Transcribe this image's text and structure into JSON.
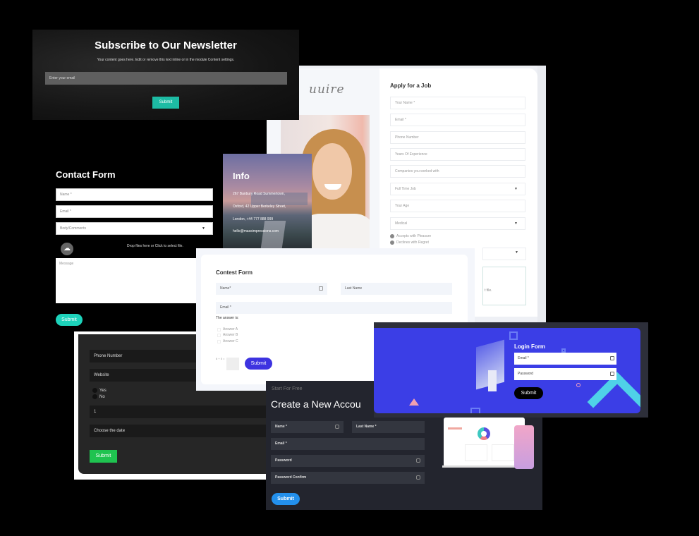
{
  "newsletter": {
    "title": "Subscribe to Our Newsletter",
    "description": "Your content goes here. Edit or remove this text inline or in the module Content settings.",
    "email_placeholder": "Enter your email",
    "submit_label": "Submit",
    "accent_color": "#1dbba4"
  },
  "job_form": {
    "logo_text": "uuire",
    "title": "Apply for a Job",
    "fields": [
      {
        "placeholder": "Your Name *"
      },
      {
        "placeholder": "Email *"
      },
      {
        "placeholder": "Phone Number"
      },
      {
        "placeholder": "Years Of Experience"
      },
      {
        "placeholder": "Companies you worked with"
      },
      {
        "placeholder": "Full Time Job",
        "type": "select"
      },
      {
        "placeholder": "Your Age"
      },
      {
        "placeholder": "Medical",
        "type": "select"
      }
    ],
    "radio_options": [
      "Accepts with Pleasure",
      "Declines with Regret"
    ],
    "upload_hint": "t file."
  },
  "contact_form": {
    "title": "Contact Form",
    "fields": [
      {
        "placeholder": "Name *"
      },
      {
        "placeholder": "Email *"
      },
      {
        "placeholder": "Body/Comments",
        "type": "select"
      }
    ],
    "drop_text": "Drop files here or Click to select file.",
    "message_placeholder": "Message",
    "submit_label": "Submit",
    "accent_color": "#1dd3bb"
  },
  "info_card": {
    "title": "Info",
    "lines": [
      "267 Banbury Road Summertown,",
      "Oxford, 42 Upper Berkeley Street,",
      "London, +44 777 888 999",
      "hello@massimpressions.com"
    ]
  },
  "contest_form": {
    "title": "Contest Form",
    "name_placeholder": "Name*",
    "last_name_placeholder": "Last Name",
    "email_placeholder": "Email *",
    "question": "The answer is:",
    "answers": [
      "Answer A",
      "Answer B",
      "Answer C"
    ],
    "captcha": "6 + 5 =",
    "submit_label": "Submit",
    "accent_color": "#3d33e0"
  },
  "dark_form": {
    "fields": [
      {
        "placeholder": "Phone Number"
      },
      {
        "placeholder": "Website"
      }
    ],
    "radio_options": [
      "Yes",
      "No"
    ],
    "number_value": "1",
    "date_placeholder": "Choose the date",
    "submit_label": "Submit",
    "accent_color": "#1fc350"
  },
  "account_form": {
    "kicker": "Start For Free",
    "title": "Create a New Accou",
    "name_placeholder": "Name *",
    "last_name_placeholder": "Last Name *",
    "email_placeholder": "Email *",
    "password_placeholder": "Password",
    "password_confirm_placeholder": "Password Confirm",
    "submit_label": "Submit",
    "accent_color": "#2390ec"
  },
  "login_form": {
    "title": "Login Form",
    "email_placeholder": "Email *",
    "password_placeholder": "Password",
    "submit_label": "Submit",
    "panel_color": "#3b3ee6"
  }
}
